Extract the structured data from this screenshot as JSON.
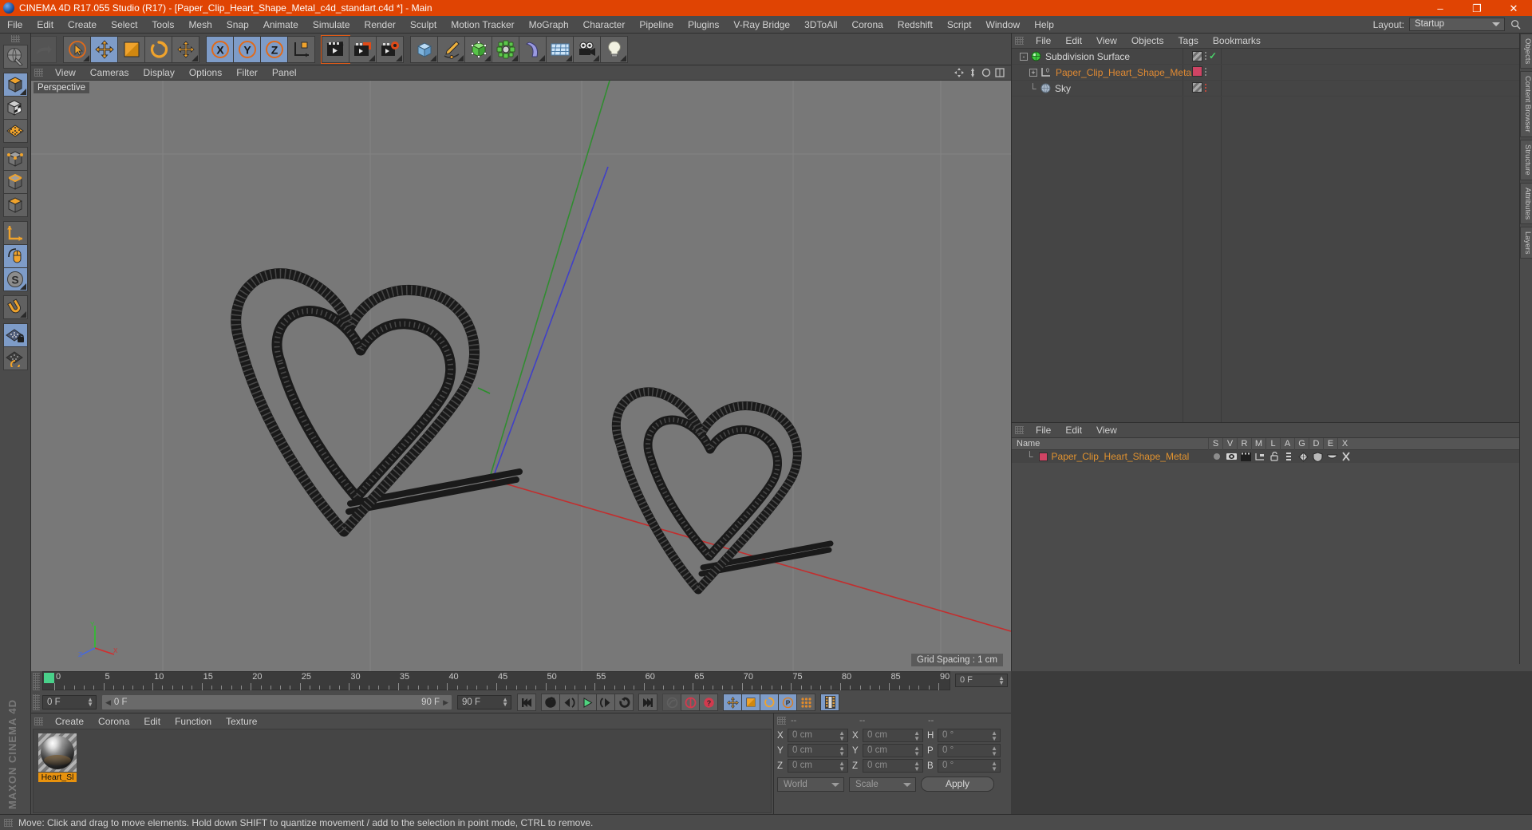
{
  "window": {
    "title": "CINEMA 4D R17.055 Studio (R17) - [Paper_Clip_Heart_Shape_Metal_c4d_standart.c4d *] - Main",
    "app_icon": "cinema4d-logo-icon",
    "minimize": "–",
    "maximize": "❐",
    "close": "✕"
  },
  "menubar": {
    "items": [
      "File",
      "Edit",
      "Create",
      "Select",
      "Tools",
      "Mesh",
      "Snap",
      "Animate",
      "Simulate",
      "Render",
      "Sculpt",
      "Motion Tracker",
      "MoGraph",
      "Character",
      "Pipeline",
      "Plugins",
      "V-Ray Bridge",
      "3DToAll",
      "Corona",
      "Redshift",
      "Script",
      "Window",
      "Help"
    ],
    "layout_label": "Layout:",
    "layout_value": "Startup",
    "search_icon": "magnifier-icon"
  },
  "left_toolbar": {
    "groups": [
      {
        "buttons": [
          {
            "name": "make-editable-icon",
            "selected": false
          }
        ]
      },
      {
        "buttons": [
          {
            "name": "model-mode-icon",
            "selected": true
          },
          {
            "name": "texture-mode-icon",
            "selected": false
          },
          {
            "name": "polygon-mode-icon",
            "selected": false
          }
        ]
      },
      {
        "buttons": [
          {
            "name": "points-mode-icon",
            "selected": false
          },
          {
            "name": "edges-mode-icon",
            "selected": false
          },
          {
            "name": "polygons-mode-icon",
            "selected": false
          }
        ]
      },
      {
        "buttons": [
          {
            "name": "axis-mode-icon",
            "selected": false
          },
          {
            "name": "viewport-solo-icon",
            "selected": true
          },
          {
            "name": "soft-selection-icon",
            "selected": true
          }
        ]
      },
      {
        "buttons": [
          {
            "name": "magnet-tool-icon",
            "selected": false
          }
        ]
      },
      {
        "buttons": [
          {
            "name": "workplane-lock-icon",
            "selected": true
          },
          {
            "name": "workplane-rotate-icon",
            "selected": false
          }
        ]
      }
    ]
  },
  "top_toolbar": {
    "groups": [
      {
        "buttons": [
          {
            "name": "undo-icon",
            "disabled": false
          },
          {
            "name": "redo-icon",
            "disabled": true
          }
        ]
      },
      {
        "buttons": [
          {
            "name": "live-selection-icon",
            "selected": false
          },
          {
            "name": "move-tool-icon",
            "selected": true
          },
          {
            "name": "scale-tool-icon",
            "selected": false
          },
          {
            "name": "rotate-tool-icon",
            "selected": false
          },
          {
            "name": "move-alt-icon",
            "selected": false
          }
        ]
      },
      {
        "buttons": [
          {
            "name": "x-axis-lock-icon",
            "selected": true
          },
          {
            "name": "y-axis-lock-icon",
            "selected": true
          },
          {
            "name": "z-axis-lock-icon",
            "selected": true
          },
          {
            "name": "world-object-axis-icon",
            "selected": false
          }
        ]
      },
      {
        "buttons": [
          {
            "name": "render-view-icon",
            "selected": false
          }
        ]
      },
      {
        "buttons": [
          {
            "name": "render-active-view-icon",
            "selected": false,
            "highlight": true
          },
          {
            "name": "render-to-picture-viewer-icon",
            "selected": false
          },
          {
            "name": "render-settings-icon",
            "selected": false
          }
        ]
      },
      {
        "buttons": [
          {
            "name": "add-cube-icon",
            "selected": false
          },
          {
            "name": "add-spline-icon",
            "selected": false
          },
          {
            "name": "add-nurbs-icon",
            "selected": false
          },
          {
            "name": "add-array-icon",
            "selected": false
          },
          {
            "name": "add-bend-deformer-icon",
            "selected": false
          },
          {
            "name": "add-floor-environment-icon",
            "selected": false
          },
          {
            "name": "add-camera-icon",
            "selected": false
          },
          {
            "name": "add-light-icon",
            "selected": false
          }
        ]
      }
    ]
  },
  "viewport": {
    "menu_items": [
      "View",
      "Cameras",
      "Display",
      "Options",
      "Filter",
      "Panel"
    ],
    "label": "Perspective",
    "grid_spacing": "Grid Spacing : 1 cm",
    "corner_icons": [
      "viewport-move-icon",
      "viewport-scale-icon",
      "viewport-rotate-icon",
      "viewport-maximize-icon"
    ],
    "axis_gizmo": {
      "x": "X",
      "y": "Y",
      "z": "Z"
    }
  },
  "object_manager": {
    "menu_items": [
      "File",
      "Edit",
      "View",
      "Objects",
      "Tags",
      "Bookmarks"
    ],
    "rows": [
      {
        "name": "Subdivision Surface",
        "indent": 0,
        "twirl": "-",
        "icon": "subdivision-surface-icon",
        "tag": "checker",
        "dots": "gray",
        "check": "✓"
      },
      {
        "name": "Paper_Clip_Heart_Shape_Metal",
        "indent": 1,
        "twirl": "+",
        "icon": "null-object-icon",
        "tag": "pink",
        "dots": "gray",
        "check": ""
      },
      {
        "name": "Sky",
        "indent": 1,
        "twirl": "",
        "icon": "sky-object-icon",
        "tag": "checker",
        "dots": "red",
        "check": ""
      }
    ]
  },
  "material_list": {
    "menu_items": [
      "File",
      "Edit",
      "View"
    ],
    "columns": [
      "Name",
      "S",
      "V",
      "R",
      "M",
      "L",
      "A",
      "G",
      "D",
      "E",
      "X"
    ],
    "rows": [
      {
        "name": "Paper_Clip_Heart_Shape_Metal",
        "icons": [
          "dot-icon",
          "visibility-icon",
          "render-icon",
          "hierarchy-icon",
          "unlock-icon",
          "list-icon",
          "deform-icon",
          "shield-icon",
          "cap-icon",
          "bone-icon"
        ]
      }
    ]
  },
  "right_tabs": [
    "Objects",
    "Content Browser",
    "Structure",
    "Attributes",
    "Layers"
  ],
  "timeline": {
    "ticks": [
      0,
      5,
      10,
      15,
      20,
      25,
      30,
      35,
      40,
      45,
      50,
      55,
      60,
      65,
      70,
      75,
      80,
      85,
      90
    ],
    "current_frame_marker": 0,
    "frame_field": "0 F"
  },
  "playbar": {
    "current_frame": "0 F",
    "range_start": "0 F",
    "range_end": "90 F",
    "end_frame": "90 F",
    "buttons": [
      {
        "name": "go-to-start-button",
        "selected": false
      },
      {
        "name": "play-reverse-button",
        "selected": false
      },
      {
        "name": "previous-frame-button",
        "selected": false
      },
      {
        "name": "play-forward-button",
        "selected": false
      },
      {
        "name": "next-frame-button",
        "selected": false
      },
      {
        "name": "play-loop-button",
        "selected": false
      },
      {
        "name": "go-to-end-button",
        "selected": false
      },
      {
        "name": "record-active-objects-button",
        "selected": false,
        "disabled": true
      },
      {
        "name": "autokeying-button",
        "selected": false
      },
      {
        "name": "keyframe-selection-button",
        "selected": false
      },
      {
        "name": "position-key-button",
        "selected": true
      },
      {
        "name": "scale-key-button",
        "selected": true
      },
      {
        "name": "rotation-key-button",
        "selected": true
      },
      {
        "name": "parameter-key-button",
        "selected": true
      },
      {
        "name": "point-level-animation-button",
        "selected": false
      },
      {
        "name": "timeline-toggle-button",
        "selected": true
      }
    ]
  },
  "material_manager": {
    "menu_items": [
      "Create",
      "Corona",
      "Edit",
      "Function",
      "Texture"
    ],
    "materials": [
      {
        "name": "Heart_Sl",
        "preview": "metal-sphere-preview"
      }
    ]
  },
  "coordinates": {
    "headers": [
      "--",
      "--",
      "--"
    ],
    "rows": [
      {
        "l1": "X",
        "v1": "0 cm",
        "l2": "X",
        "v2": "0 cm",
        "l3": "H",
        "v3": "0 °"
      },
      {
        "l1": "Y",
        "v1": "0 cm",
        "l2": "Y",
        "v2": "0 cm",
        "l3": "P",
        "v3": "0 °"
      },
      {
        "l1": "Z",
        "v1": "0 cm",
        "l2": "Z",
        "v2": "0 cm",
        "l3": "B",
        "v3": "0 °"
      }
    ],
    "space_dropdown": "World",
    "mode_dropdown": "Scale",
    "apply_button": "Apply"
  },
  "statusbar": {
    "message": "Move: Click and drag to move elements. Hold down SHIFT to quantize movement / add to the selection in point mode, CTRL to remove."
  },
  "branding": {
    "text": "MAXON CINEMA 4D"
  },
  "colors": {
    "title_bar": "#e04403",
    "panel": "#4b4b4b",
    "button": "#616161",
    "selected_button": "#7e9cc8",
    "viewport_bg": "#787878",
    "accent_orange": "#e0922f",
    "material_pink": "#cf4464",
    "green_check": "#4bd26a"
  }
}
